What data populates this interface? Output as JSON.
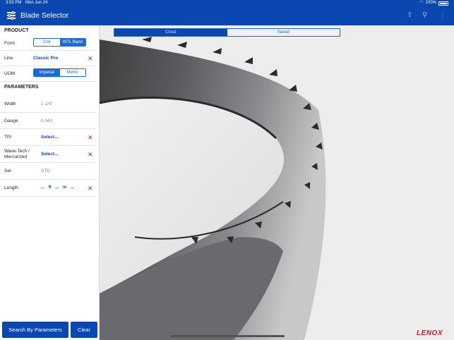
{
  "statusbar": {
    "time": "3:53 PM",
    "date": "Mon Jun 24",
    "battery": "100%"
  },
  "appbar": {
    "title": "Blade Selector"
  },
  "product": {
    "heading": "PRODUCT",
    "form_label": "Form",
    "form_options": [
      "Coil",
      "WTL Band"
    ],
    "form_selected": "WTL Band",
    "line_label": "Line",
    "line_value": "Classic Pro",
    "uom_label": "UOM",
    "uom_options": [
      "Imperial",
      "Metric"
    ],
    "uom_selected": "Imperial"
  },
  "parameters": {
    "heading": "PARAMETERS",
    "width_label": "Width",
    "width_value": "1 1/4\"",
    "gauge_label": "Gauge",
    "gauge_value": "0.042",
    "tpi_label": "TPI",
    "tpi_value": "Select...",
    "wavetech_label": "Wave-Tech / Mercurized",
    "wavetech_value": "Select...",
    "set_label": "Set",
    "set_value": "STD",
    "length_label": "Length",
    "length_parts": [
      "...",
      "ft",
      "...",
      "in",
      "..."
    ]
  },
  "buttons": {
    "search": "Search By Parameters",
    "clear": "Clear"
  },
  "view_tabs": {
    "cloud": "Cloud",
    "saved": "Saved",
    "selected": "Cloud"
  },
  "brand": {
    "logo_text": "LENOX",
    "accent": "#0b47b0",
    "remove_color": "#c0202a"
  }
}
